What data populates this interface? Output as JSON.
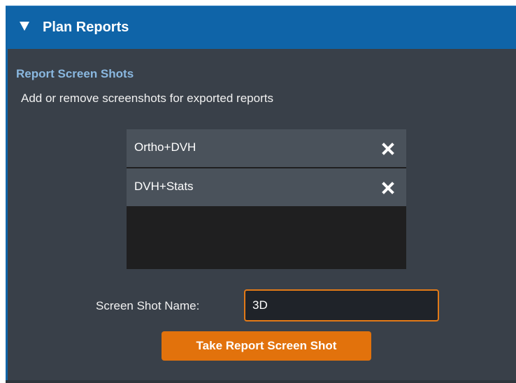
{
  "panel": {
    "title": "Plan Reports",
    "collapse_icon": "triangle-down-icon",
    "accent_color": "#0f64a8"
  },
  "section": {
    "title": "Report Screen Shots",
    "description": "Add or remove screenshots for exported reports"
  },
  "screenshots": {
    "items": [
      {
        "label": "Ortho+DVH",
        "remove_icon": "close-icon"
      },
      {
        "label": "DVH+Stats",
        "remove_icon": "close-icon"
      }
    ]
  },
  "name_field": {
    "label": "Screen Shot Name:",
    "value": "3D",
    "border_color": "#e37a17"
  },
  "actions": {
    "take_screenshot_label": "Take Report Screen Shot",
    "button_color": "#e2720c"
  }
}
